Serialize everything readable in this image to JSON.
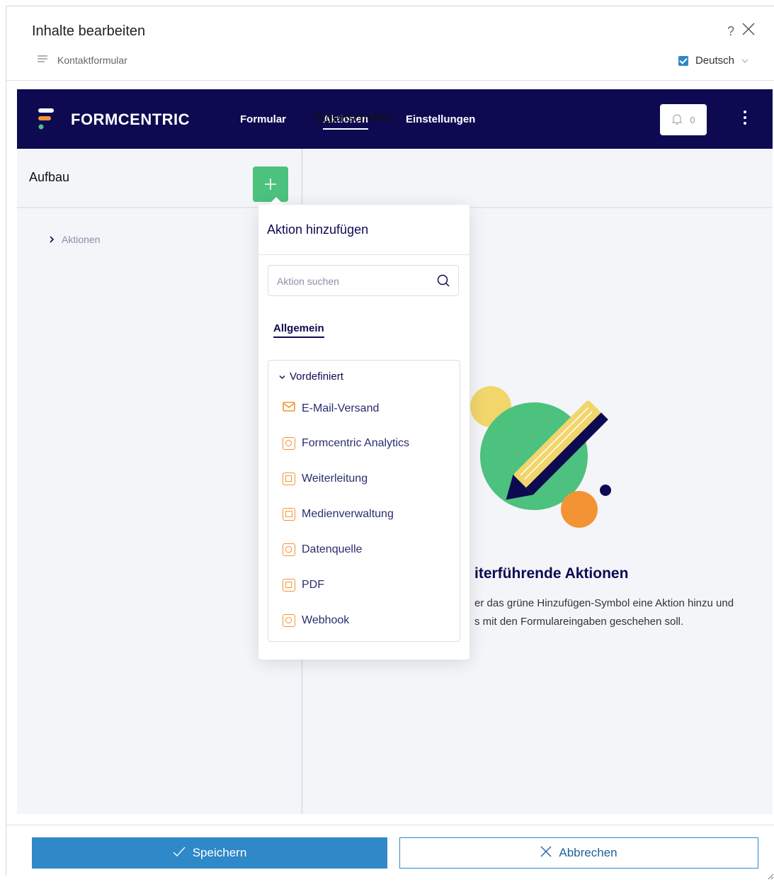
{
  "dialog": {
    "title": "Inhalte bearbeiten",
    "help": "?",
    "subtitle": "Kontaktformular",
    "language": "Deutsch"
  },
  "app": {
    "brand": "FORMCENTRIC",
    "nav": [
      "Formular",
      "Aktionen",
      "Einstellungen"
    ],
    "notifications": "0",
    "left_title": "Aufbau",
    "right_title": "Eigenschaften",
    "tree_item": "Aktionen",
    "empty_title": "iterführende Aktionen",
    "empty_text_line1": "er das grüne Hinzufügen-Symbol eine Aktion hinzu und",
    "empty_text_line2": "s mit den Formulareingaben geschehen soll."
  },
  "popup": {
    "title": "Aktion hinzufügen",
    "search_placeholder": "Aktion suchen",
    "tab": "Allgemein",
    "group": "Vordefiniert",
    "items": [
      "E-Mail-Versand",
      "Formcentric Analytics",
      "Weiterleitung",
      "Medienverwaltung",
      "Datenquelle",
      "PDF",
      "Webhook"
    ]
  },
  "footer": {
    "save": "Speichern",
    "cancel": "Abbrechen"
  },
  "colors": {
    "navy": "#0d0a52",
    "green": "#4dc17e",
    "orange": "#f39434",
    "blue": "#2f88c8",
    "yellow": "#f2d56b"
  }
}
